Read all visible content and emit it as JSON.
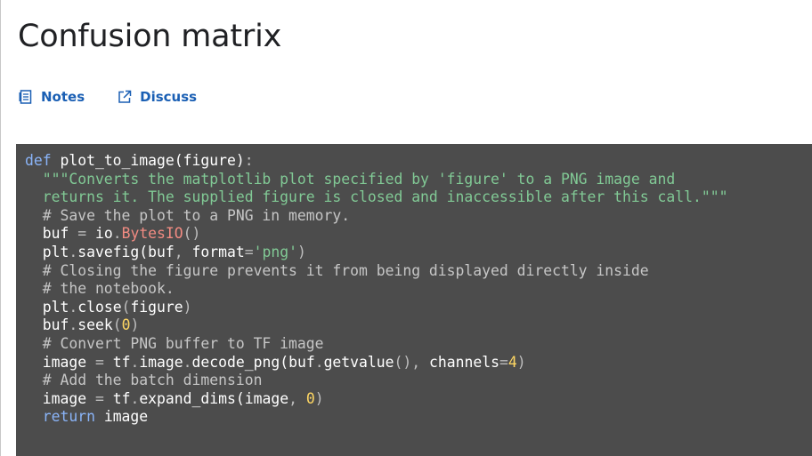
{
  "page": {
    "title": "Confusion matrix"
  },
  "links": {
    "notes_label": "Notes",
    "notes_icon": "notes-icon",
    "discuss_label": "Discuss",
    "discuss_icon": "external-link-icon"
  },
  "colors": {
    "link": "#1a5fb4",
    "code_background": "#4c4c4c",
    "keyword": "#8ab4f8",
    "string": "#81c995",
    "comment": "#c6c6c6",
    "number": "#fdd663",
    "class_name": "#f28b82"
  },
  "code": {
    "lines": [
      [
        [
          "kw",
          "def"
        ],
        [
          "txt",
          " plot_to_image(figure)"
        ],
        [
          "op",
          ":"
        ]
      ],
      [
        [
          "str",
          "  \"\"\"Converts the matplotlib plot specified by 'figure' to a PNG image and"
        ]
      ],
      [
        [
          "str",
          "  returns it. The supplied figure is closed and inaccessible after this call.\"\"\""
        ]
      ],
      [
        [
          "com",
          "  # Save the plot to a PNG in memory."
        ]
      ],
      [
        [
          "txt",
          "  buf "
        ],
        [
          "op",
          "="
        ],
        [
          "txt",
          " io"
        ],
        [
          "op",
          "."
        ],
        [
          "cls",
          "BytesIO"
        ],
        [
          "op",
          "()"
        ]
      ],
      [
        [
          "txt",
          "  plt"
        ],
        [
          "op",
          "."
        ],
        [
          "txt",
          "savefig(buf"
        ],
        [
          "op",
          ","
        ],
        [
          "txt",
          " format"
        ],
        [
          "op",
          "="
        ],
        [
          "str",
          "'png'"
        ],
        [
          "op",
          ")"
        ]
      ],
      [
        [
          "com",
          "  # Closing the figure prevents it from being displayed directly inside"
        ]
      ],
      [
        [
          "com",
          "  # the notebook."
        ]
      ],
      [
        [
          "txt",
          "  plt"
        ],
        [
          "op",
          "."
        ],
        [
          "txt",
          "close"
        ],
        [
          "op",
          "("
        ],
        [
          "txt",
          "figure"
        ],
        [
          "op",
          ")"
        ]
      ],
      [
        [
          "txt",
          "  buf"
        ],
        [
          "op",
          "."
        ],
        [
          "txt",
          "seek"
        ],
        [
          "op",
          "("
        ],
        [
          "num",
          "0"
        ],
        [
          "op",
          ")"
        ]
      ],
      [
        [
          "com",
          "  # Convert PNG buffer to TF image"
        ]
      ],
      [
        [
          "txt",
          "  image "
        ],
        [
          "op",
          "="
        ],
        [
          "txt",
          " tf"
        ],
        [
          "op",
          "."
        ],
        [
          "txt",
          "image"
        ],
        [
          "op",
          "."
        ],
        [
          "txt",
          "decode_png(buf"
        ],
        [
          "op",
          "."
        ],
        [
          "txt",
          "getvalue"
        ],
        [
          "op",
          "(),"
        ],
        [
          "txt",
          " channels"
        ],
        [
          "op",
          "="
        ],
        [
          "num",
          "4"
        ],
        [
          "op",
          ")"
        ]
      ],
      [
        [
          "com",
          "  # Add the batch dimension"
        ]
      ],
      [
        [
          "txt",
          "  image "
        ],
        [
          "op",
          "="
        ],
        [
          "txt",
          " tf"
        ],
        [
          "op",
          "."
        ],
        [
          "txt",
          "expand_dims(image"
        ],
        [
          "op",
          ","
        ],
        [
          "txt",
          " "
        ],
        [
          "num",
          "0"
        ],
        [
          "op",
          ")"
        ]
      ],
      [
        [
          "kw",
          "  return"
        ],
        [
          "txt",
          " image"
        ]
      ]
    ]
  }
}
